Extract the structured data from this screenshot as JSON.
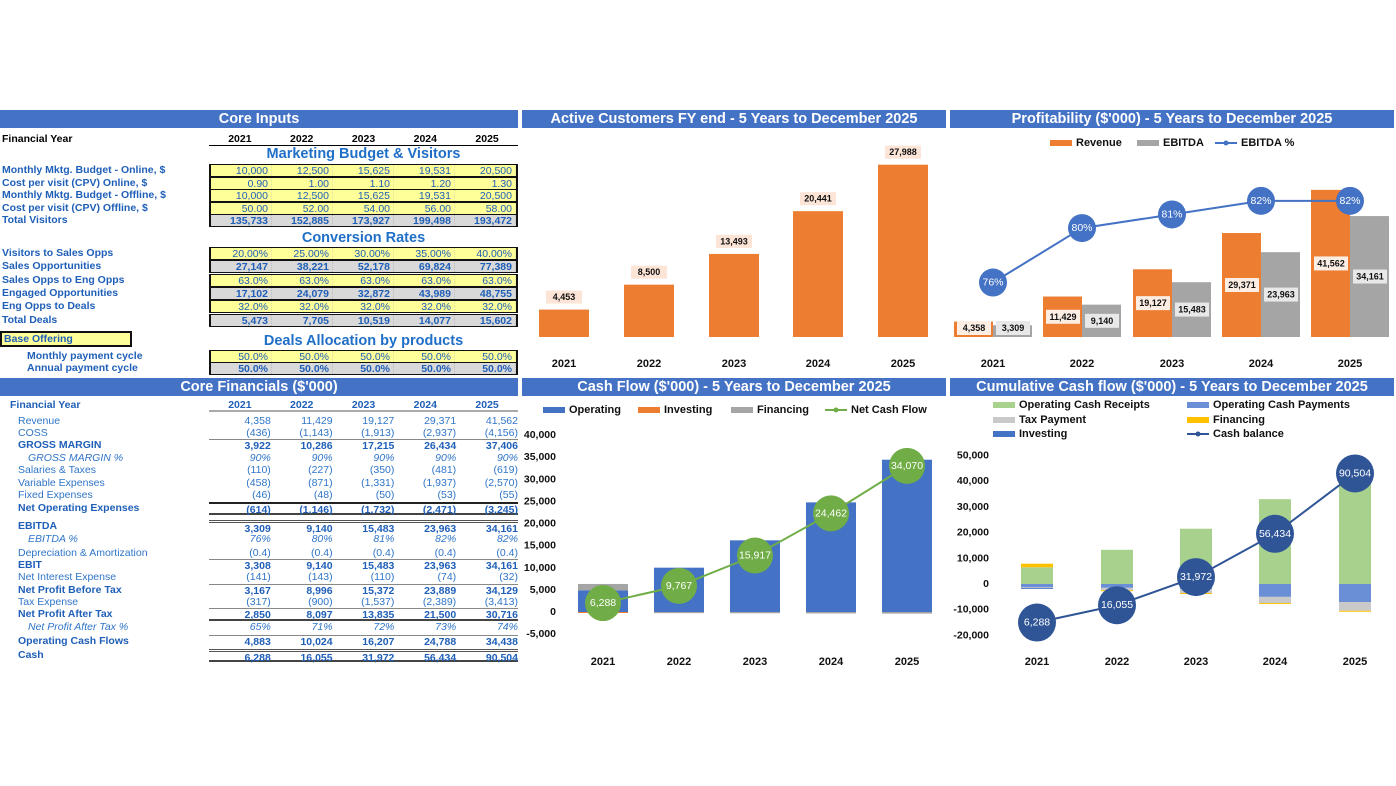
{
  "colors": {
    "header": "#4472C4",
    "orange": "#ED7D31",
    "gray": "#A5A5A5",
    "blue": "#4472C4",
    "green": "#70AD47",
    "dark_blue": "#2F5597",
    "light_green": "#A9D18E",
    "mid_blue": "#6A8FD6",
    "light_gray": "#C9C9C9",
    "gold": "#FFC000",
    "input_yellow": "#FFFF99",
    "calc_gray": "#D9D9D9"
  },
  "core_inputs": {
    "title": "Core Inputs",
    "fy_label": "Financial Year",
    "years": [
      "2021",
      "2022",
      "2023",
      "2024",
      "2025"
    ],
    "marketing_heading": "Marketing Budget & Visitors",
    "marketing_rows": [
      {
        "label": "Monthly Mktg. Budget - Online, $",
        "values": [
          "10,000",
          "12,500",
          "15,625",
          "19,531",
          "20,500"
        ],
        "kind": "input"
      },
      {
        "label": "Cost per visit (CPV) Online, $",
        "values": [
          "0.90",
          "1.00",
          "1.10",
          "1.20",
          "1.30"
        ],
        "kind": "input"
      },
      {
        "label": "Monthly Mktg. Budget - Offline, $",
        "values": [
          "10,000",
          "12,500",
          "15,625",
          "19,531",
          "20,500"
        ],
        "kind": "input"
      },
      {
        "label": "Cost per visit (CPV) Offline, $",
        "values": [
          "50.00",
          "52.00",
          "54.00",
          "56.00",
          "58.00"
        ],
        "kind": "input"
      },
      {
        "label": "Total Visitors",
        "values": [
          "135,733",
          "152,885",
          "173,927",
          "199,498",
          "193,472"
        ],
        "kind": "calc"
      }
    ],
    "conversion_heading": "Conversion Rates",
    "conversion_rows": [
      {
        "label": "Visitors to Sales Opps",
        "values": [
          "20.00%",
          "25.00%",
          "30.00%",
          "35.00%",
          "40.00%"
        ],
        "kind": "input"
      },
      {
        "label": "Sales Opportunities",
        "values": [
          "27,147",
          "38,221",
          "52,178",
          "69,824",
          "77,389"
        ],
        "kind": "calc"
      },
      {
        "label": "Sales Opps to Eng Opps",
        "values": [
          "63.0%",
          "63.0%",
          "63.0%",
          "63.0%",
          "63.0%"
        ],
        "kind": "input"
      },
      {
        "label": "Engaged Opportunities",
        "values": [
          "17,102",
          "24,079",
          "32,872",
          "43,989",
          "48,755"
        ],
        "kind": "calc"
      },
      {
        "label": "Eng Opps to Deals",
        "values": [
          "32.0%",
          "32.0%",
          "32.0%",
          "32.0%",
          "32.0%"
        ],
        "kind": "input"
      },
      {
        "label": "Total Deals",
        "values": [
          "5,473",
          "7,705",
          "10,519",
          "14,077",
          "15,602"
        ],
        "kind": "calc"
      }
    ],
    "base_offering_label": "Base Offering",
    "deals_heading": "Deals Allocation by products",
    "deals_rows": [
      {
        "label": "Monthly payment cycle",
        "values": [
          "50.0%",
          "50.0%",
          "50.0%",
          "50.0%",
          "50.0%"
        ],
        "kind": "input"
      },
      {
        "label": "Annual payment cycle",
        "values": [
          "50.0%",
          "50.0%",
          "50.0%",
          "50.0%",
          "50.0%"
        ],
        "kind": "calc"
      }
    ]
  },
  "core_financials": {
    "title": "Core Financials ($'000)",
    "fy_label": "Financial Year",
    "years": [
      "2021",
      "2022",
      "2023",
      "2024",
      "2025"
    ],
    "rows": [
      {
        "label": "Revenue",
        "values": [
          "4,358",
          "11,429",
          "19,127",
          "29,371",
          "41,562"
        ],
        "style": "normal"
      },
      {
        "label": "COSS",
        "values": [
          "(436)",
          "(1,143)",
          "(1,913)",
          "(2,937)",
          "(4,156)"
        ],
        "style": "normal"
      },
      {
        "label": "GROSS MARGIN",
        "values": [
          "3,922",
          "10,286",
          "17,215",
          "26,434",
          "37,406"
        ],
        "style": "bold"
      },
      {
        "label": "GROSS MARGIN %",
        "values": [
          "90%",
          "90%",
          "90%",
          "90%",
          "90%"
        ],
        "style": "italic"
      },
      {
        "label": "Salaries & Taxes",
        "values": [
          "(110)",
          "(227)",
          "(350)",
          "(481)",
          "(619)"
        ],
        "style": "normal"
      },
      {
        "label": "Variable Expenses",
        "values": [
          "(458)",
          "(871)",
          "(1,331)",
          "(1,937)",
          "(2,570)"
        ],
        "style": "normal"
      },
      {
        "label": "Fixed Expenses",
        "values": [
          "(46)",
          "(48)",
          "(50)",
          "(53)",
          "(55)"
        ],
        "style": "normal"
      },
      {
        "label": "Net Operating Expenses",
        "values": [
          "(614)",
          "(1,146)",
          "(1,732)",
          "(2,471)",
          "(3,245)"
        ],
        "style": "bold"
      },
      {
        "label": "EBITDA",
        "values": [
          "3,309",
          "9,140",
          "15,483",
          "23,963",
          "34,161"
        ],
        "style": "bold"
      },
      {
        "label": "EBITDA %",
        "values": [
          "76%",
          "80%",
          "81%",
          "82%",
          "82%"
        ],
        "style": "italic"
      },
      {
        "label": "Depreciation & Amortization",
        "values": [
          "(0.4)",
          "(0.4)",
          "(0.4)",
          "(0.4)",
          "(0.4)"
        ],
        "style": "normal"
      },
      {
        "label": "EBIT",
        "values": [
          "3,308",
          "9,140",
          "15,483",
          "23,963",
          "34,161"
        ],
        "style": "bold"
      },
      {
        "label": "Net Interest Expense",
        "values": [
          "(141)",
          "(143)",
          "(110)",
          "(74)",
          "(32)"
        ],
        "style": "normal"
      },
      {
        "label": "Net Profit Before Tax",
        "values": [
          "3,167",
          "8,996",
          "15,372",
          "23,889",
          "34,129"
        ],
        "style": "bold"
      },
      {
        "label": "Tax Expense",
        "values": [
          "(317)",
          "(900)",
          "(1,537)",
          "(2,389)",
          "(3,413)"
        ],
        "style": "normal"
      },
      {
        "label": "Net Profit After Tax",
        "values": [
          "2,850",
          "8,097",
          "13,835",
          "21,500",
          "30,716"
        ],
        "style": "bold"
      },
      {
        "label": "Net Profit After Tax %",
        "values": [
          "65%",
          "71%",
          "72%",
          "73%",
          "74%"
        ],
        "style": "italic"
      },
      {
        "label": "Operating Cash Flows",
        "values": [
          "4,883",
          "10,024",
          "16,207",
          "24,788",
          "34,438"
        ],
        "style": "bold"
      },
      {
        "label": "Cash",
        "values": [
          "6,288",
          "16,055",
          "31,972",
          "56,434",
          "90,504"
        ],
        "style": "bold"
      }
    ]
  },
  "chart_data": [
    {
      "id": "customers",
      "type": "bar",
      "title": "Active Customers FY end - 5 Years to December 2025",
      "categories": [
        "2021",
        "2022",
        "2023",
        "2024",
        "2025"
      ],
      "values": [
        4453,
        8500,
        13493,
        20441,
        27988
      ],
      "data_labels": [
        "4,453",
        "8,500",
        "13,493",
        "20,441",
        "27,988"
      ],
      "ylim": [
        0,
        32000
      ],
      "grid": false,
      "legend": "none"
    },
    {
      "id": "profitability",
      "type": "bar",
      "title": "Profitability ($'000) - 5 Years to December 2025",
      "categories": [
        "2021",
        "2022",
        "2023",
        "2024",
        "2025"
      ],
      "series": [
        {
          "name": "Revenue",
          "values": [
            4358,
            11429,
            19127,
            29371,
            41562
          ],
          "labels": [
            "4,358",
            "11,429",
            "19,127",
            "29,371",
            "41,562"
          ],
          "color": "#ED7D31"
        },
        {
          "name": "EBITDA",
          "values": [
            3309,
            9140,
            15483,
            23963,
            34161
          ],
          "labels": [
            "3,309",
            "9,140",
            "15,483",
            "23,963",
            "34,161"
          ],
          "color": "#A5A5A5"
        },
        {
          "name": "EBITDA %",
          "type": "line",
          "axis": "secondary",
          "values": [
            76,
            80,
            81,
            82,
            82
          ],
          "labels": [
            "76%",
            "80%",
            "81%",
            "82%",
            "82%"
          ],
          "color": "#4472C4"
        }
      ],
      "ylim": [
        0,
        50000
      ],
      "y2lim": [
        72,
        85
      ],
      "grid": false,
      "legend": "top"
    },
    {
      "id": "cashflow",
      "type": "bar",
      "title": "Cash Flow ($'000) - 5 Years to December 2025",
      "categories": [
        "2021",
        "2022",
        "2023",
        "2024",
        "2025"
      ],
      "series": [
        {
          "name": "Operating",
          "values": [
            4883,
            10024,
            16207,
            24788,
            34438
          ],
          "color": "#4472C4"
        },
        {
          "name": "Investing",
          "values": [
            -50,
            0,
            0,
            0,
            0
          ],
          "color": "#ED7D31"
        },
        {
          "name": "Financing",
          "values": [
            1455,
            -257,
            -290,
            -326,
            -368
          ],
          "color": "#A5A5A5"
        },
        {
          "name": "Net Cash Flow",
          "type": "line",
          "axis": "secondary",
          "values": [
            6288,
            9767,
            15917,
            24462,
            34070
          ],
          "labels": [
            "6,288",
            "9,767",
            "15,917",
            "24,462",
            "34,070"
          ],
          "color": "#70AD47"
        }
      ],
      "yticks": [
        "40,000",
        "35,000",
        "30,000",
        "25,000",
        "20,000",
        "15,000",
        "10,000",
        "5,000",
        "0",
        "-5,000"
      ],
      "ylim": [
        -5000,
        40000
      ],
      "y2lim": [
        0,
        40300
      ],
      "stacked": true,
      "grid": false,
      "legend": "top"
    },
    {
      "id": "cumulative",
      "type": "bar",
      "title": "Cumulative Cash flow ($'000) - 5 Years to December 2025",
      "categories": [
        "2021",
        "2022",
        "2023",
        "2024",
        "2025"
      ],
      "series": [
        {
          "name": "Operating Cash Receipts",
          "values": [
            6500,
            13300,
            21500,
            33000,
            40500
          ],
          "color": "#A9D18E"
        },
        {
          "name": "Operating Cash Payments",
          "values": [
            -1200,
            -1500,
            -2000,
            -5000,
            -7000
          ],
          "color": "#6A8FD6"
        },
        {
          "name": "Tax Payment",
          "values": [
            -300,
            -900,
            -1500,
            -2400,
            -3400
          ],
          "color": "#C9C9C9"
        },
        {
          "name": "Financing",
          "values": [
            1400,
            -300,
            -300,
            -300,
            -300
          ],
          "color": "#FFC000"
        },
        {
          "name": "Investing",
          "values": [
            -100,
            0,
            0,
            0,
            0
          ],
          "color": "#4472C4"
        },
        {
          "name": "Cash balance",
          "type": "line",
          "axis": "secondary",
          "values": [
            6288,
            16055,
            31972,
            56434,
            90504
          ],
          "labels": [
            "6,288",
            "16,055",
            "31,972",
            "56,434",
            "90,504"
          ],
          "color": "#2F5597"
        }
      ],
      "yticks": [
        "50,000",
        "40,000",
        "30,000",
        "20,000",
        "10,000",
        "0",
        "-10,000",
        "-20,000"
      ],
      "ylim": [
        -20000,
        50000
      ],
      "y2lim": [
        -1000,
        100700
      ],
      "stacked": true,
      "grid": false,
      "legend": "top"
    }
  ]
}
